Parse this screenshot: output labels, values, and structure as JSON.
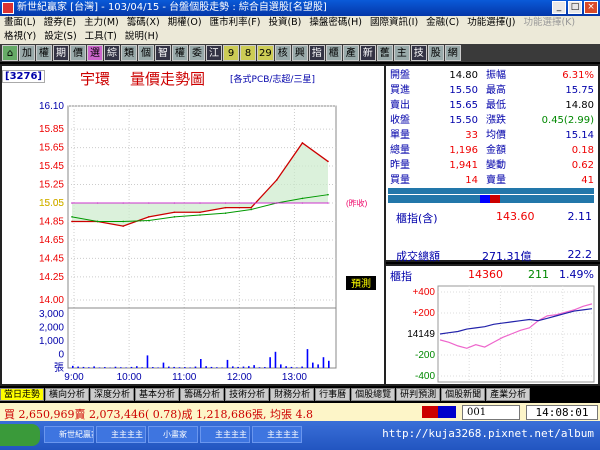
{
  "window": {
    "title": "新世紀贏家 [台灣] - 103/04/15 - 台盤個股走勢 : 綜合自選股[名望股]"
  },
  "menu": {
    "row1": [
      "畫面(L)",
      "證券(E)",
      "主力(M)",
      "籌碼(X)",
      "期權(O)",
      "匯市利率(F)",
      "投資(B)",
      "操盤密碼(H)",
      "國際資訊(I)",
      "金融(C)",
      "功能選擇(J)",
      "功能選擇(K)"
    ],
    "row2": [
      "格視(Y)",
      "設定(S)",
      "工具(T)",
      "說明(H)"
    ],
    "disabled_index": 11
  },
  "toolbar": {
    "buttons": [
      "",
      "加",
      "權",
      "期",
      "價",
      "選",
      "綜",
      "類",
      "個",
      "智",
      "權",
      "委",
      "江",
      "9",
      "8",
      "29",
      "核",
      "興",
      "指",
      "櫃",
      "產",
      "新",
      "舊",
      "主",
      "技",
      "股",
      "網"
    ]
  },
  "chart": {
    "code": "[3276]",
    "name": "宇環",
    "title": "量價走勢圖",
    "subtitle": "[各式PCB/志超/三星]",
    "y_tick_labels": [
      "16.10",
      "15.85",
      "15.65",
      "15.45",
      "15.25",
      "15.05",
      "14.85",
      "14.65",
      "14.45",
      "14.25",
      "14.00"
    ],
    "ref_label": "15.05",
    "ref_tag": "(昨收)",
    "vol_tick_labels": [
      "3,000",
      "2,000",
      "1,000",
      "0",
      "張"
    ],
    "x_tick_labels": [
      "9:00",
      "10:00",
      "11:00",
      "12:00",
      "13:00"
    ],
    "forecast_button": "預測"
  },
  "chart_data": {
    "type": "line",
    "title": "量價走勢圖",
    "x": [
      "9:00",
      "9:30",
      "10:00",
      "10:30",
      "11:00",
      "11:30",
      "12:00",
      "12:30",
      "13:00",
      "13:15",
      "13:30"
    ],
    "series": [
      {
        "name": "price",
        "values": [
          14.85,
          14.85,
          14.8,
          14.9,
          14.95,
          14.95,
          15.0,
          15.0,
          15.3,
          15.7,
          15.5
        ]
      },
      {
        "name": "average",
        "values": [
          14.9,
          14.85,
          14.85,
          14.86,
          14.9,
          14.92,
          14.94,
          14.98,
          15.05,
          15.1,
          15.14
        ]
      },
      {
        "name": "reference",
        "values": [
          15.05,
          15.05,
          15.05,
          15.05,
          15.05,
          15.05,
          15.05,
          15.05,
          15.05,
          15.05,
          15.05
        ]
      }
    ],
    "volume_sample": [
      120,
      80,
      60,
      40,
      90,
      30,
      50,
      20,
      70,
      40,
      30,
      60,
      100,
      40,
      700,
      50,
      30,
      300,
      80,
      60,
      40,
      50,
      30,
      80,
      500,
      100,
      60,
      40,
      30,
      450,
      90,
      60,
      80,
      100,
      160,
      40,
      50,
      600,
      900,
      200,
      100,
      60,
      30,
      80,
      1050,
      300,
      200,
      600,
      400
    ],
    "ylim": [
      14.0,
      16.1
    ],
    "vol_ylim": [
      0,
      3000
    ]
  },
  "quote": {
    "rows": [
      {
        "l1": "開盤",
        "v1": "14.80",
        "c1": "blk",
        "l2": "振幅",
        "v2": "6.31%",
        "c2": "red"
      },
      {
        "l1": "買進",
        "v1": "15.50",
        "c1": "blu",
        "l2": "最高",
        "v2": "15.75",
        "c2": "blu"
      },
      {
        "l1": "賣出",
        "v1": "15.65",
        "c1": "blu",
        "l2": "最低",
        "v2": "14.80",
        "c2": "blk"
      },
      {
        "l1": "收盤",
        "v1": "15.50",
        "c1": "blu",
        "l2": "漲跌",
        "v2": "0.45(2.99)",
        "c2": "grn"
      },
      {
        "l1": "單量",
        "v1": "33",
        "c1": "red",
        "l2": "均價",
        "v2": "15.14",
        "c2": "blu"
      },
      {
        "l1": "總量",
        "v1": "1,196",
        "c1": "red",
        "l2": "金額",
        "v2": "0.18",
        "c2": "red"
      },
      {
        "l1": "昨量",
        "v1": "1,941",
        "c1": "red",
        "l2": "變動",
        "v2": "0.62",
        "c2": "red"
      },
      {
        "l1": "買量",
        "v1": "14",
        "c1": "red",
        "l2": "賣量",
        "v2": "41",
        "c2": "red"
      }
    ],
    "index_label": "櫃指(含)",
    "index_value": "143.60",
    "index_change": "2.11",
    "turnover_label": "成交總額",
    "turnover_value": "271.31億",
    "turnover_change": "22.2"
  },
  "mini_chart": {
    "label": "櫃指",
    "value": "14360",
    "change": "211",
    "pct": "1.49%",
    "tick_labels": [
      "+400",
      "+200",
      "14149",
      "-200",
      "-400"
    ],
    "index_values": [
      14149,
      14160,
      14170,
      14190,
      14200,
      14210,
      14230,
      14240,
      14250,
      14260,
      14270,
      14260,
      14280,
      14300,
      14320,
      14340,
      14350,
      14360
    ],
    "adv_values": [
      14100,
      14080,
      14050,
      14030,
      14060,
      14040,
      14080,
      14120,
      14150,
      14180,
      14200,
      14260,
      14300,
      14310,
      14330,
      14350,
      14380,
      14400
    ]
  },
  "tabs": [
    "當日走勢",
    "橫向分析",
    "深度分析",
    "基本分析",
    "籌碼分析",
    "技術分析",
    "財務分析",
    "行事曆",
    "個股總覽",
    "研判預測",
    "個股新聞",
    "產業分析"
  ],
  "status": {
    "text": "買 2,650,969賣 2,073,446( 0.78)成 1,218,686張, 均張 4.8",
    "code": "001",
    "time": "14:08:01"
  },
  "taskbar": {
    "items": [
      "新世紀贏家",
      "主主主主",
      "小畫家",
      "主主主主",
      "主主主主"
    ],
    "watermark": "http://kuja3268.pixnet.net/album"
  }
}
